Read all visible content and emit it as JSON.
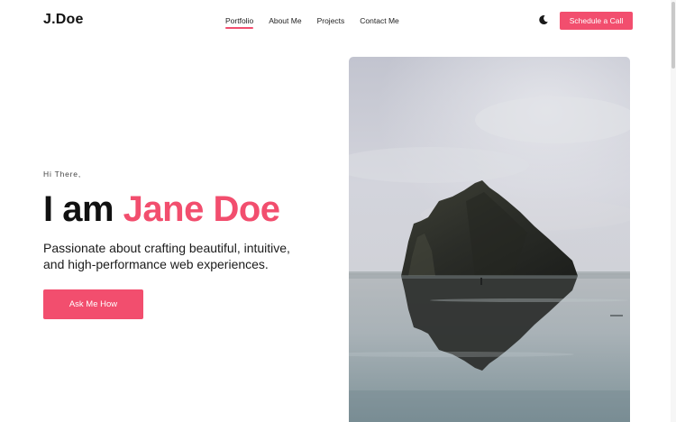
{
  "brand": {
    "logo": "J.Doe",
    "accent_color": "#f24e6e"
  },
  "nav": {
    "links": [
      {
        "label": "Portfolio",
        "active": true
      },
      {
        "label": "About Me",
        "active": false
      },
      {
        "label": "Projects",
        "active": false
      },
      {
        "label": "Contact Me",
        "active": false
      }
    ],
    "theme_toggle_icon": "moon-icon",
    "cta_label": "Schedule a Call"
  },
  "hero": {
    "greeting": "Hi There,",
    "headline_prefix": "I am ",
    "headline_name": "Jane Doe",
    "tagline": "Passionate about crafting beautiful, intuitive, and high-performance web experiences.",
    "button_label": "Ask Me How"
  }
}
